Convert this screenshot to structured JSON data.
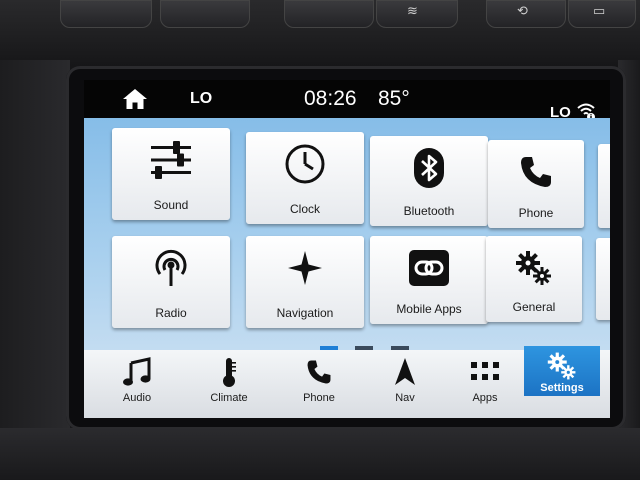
{
  "status_bar": {
    "left_temp": "LO",
    "time": "08:26",
    "outside_temp": "85°",
    "right_temp": "LO"
  },
  "tiles": [
    {
      "label": "Sound",
      "icon": "sliders-icon"
    },
    {
      "label": "Clock",
      "icon": "clock-icon"
    },
    {
      "label": "Bluetooth",
      "icon": "bluetooth-icon"
    },
    {
      "label": "Phone",
      "icon": "phone-icon"
    },
    {
      "label": "Radio",
      "icon": "radio-icon"
    },
    {
      "label": "Navigation",
      "icon": "compass-star-icon"
    },
    {
      "label": "Mobile Apps",
      "icon": "link-icon"
    },
    {
      "label": "General",
      "icon": "gears-icon"
    }
  ],
  "pagination": {
    "pages": 3,
    "current": 1
  },
  "nav_bar": [
    {
      "label": "Audio",
      "icon": "music-note-icon"
    },
    {
      "label": "Climate",
      "icon": "thermometer-icon"
    },
    {
      "label": "Phone",
      "icon": "phone-icon"
    },
    {
      "label": "Nav",
      "icon": "nav-arrow-icon"
    },
    {
      "label": "Apps",
      "icon": "apps-grid-icon"
    },
    {
      "label": "Settings",
      "icon": "gears-icon",
      "selected": true
    }
  ],
  "colors": {
    "accent": "#1f7fd6",
    "screen_background": "#a9d0ee",
    "selected_nav": "#2e95e0"
  }
}
